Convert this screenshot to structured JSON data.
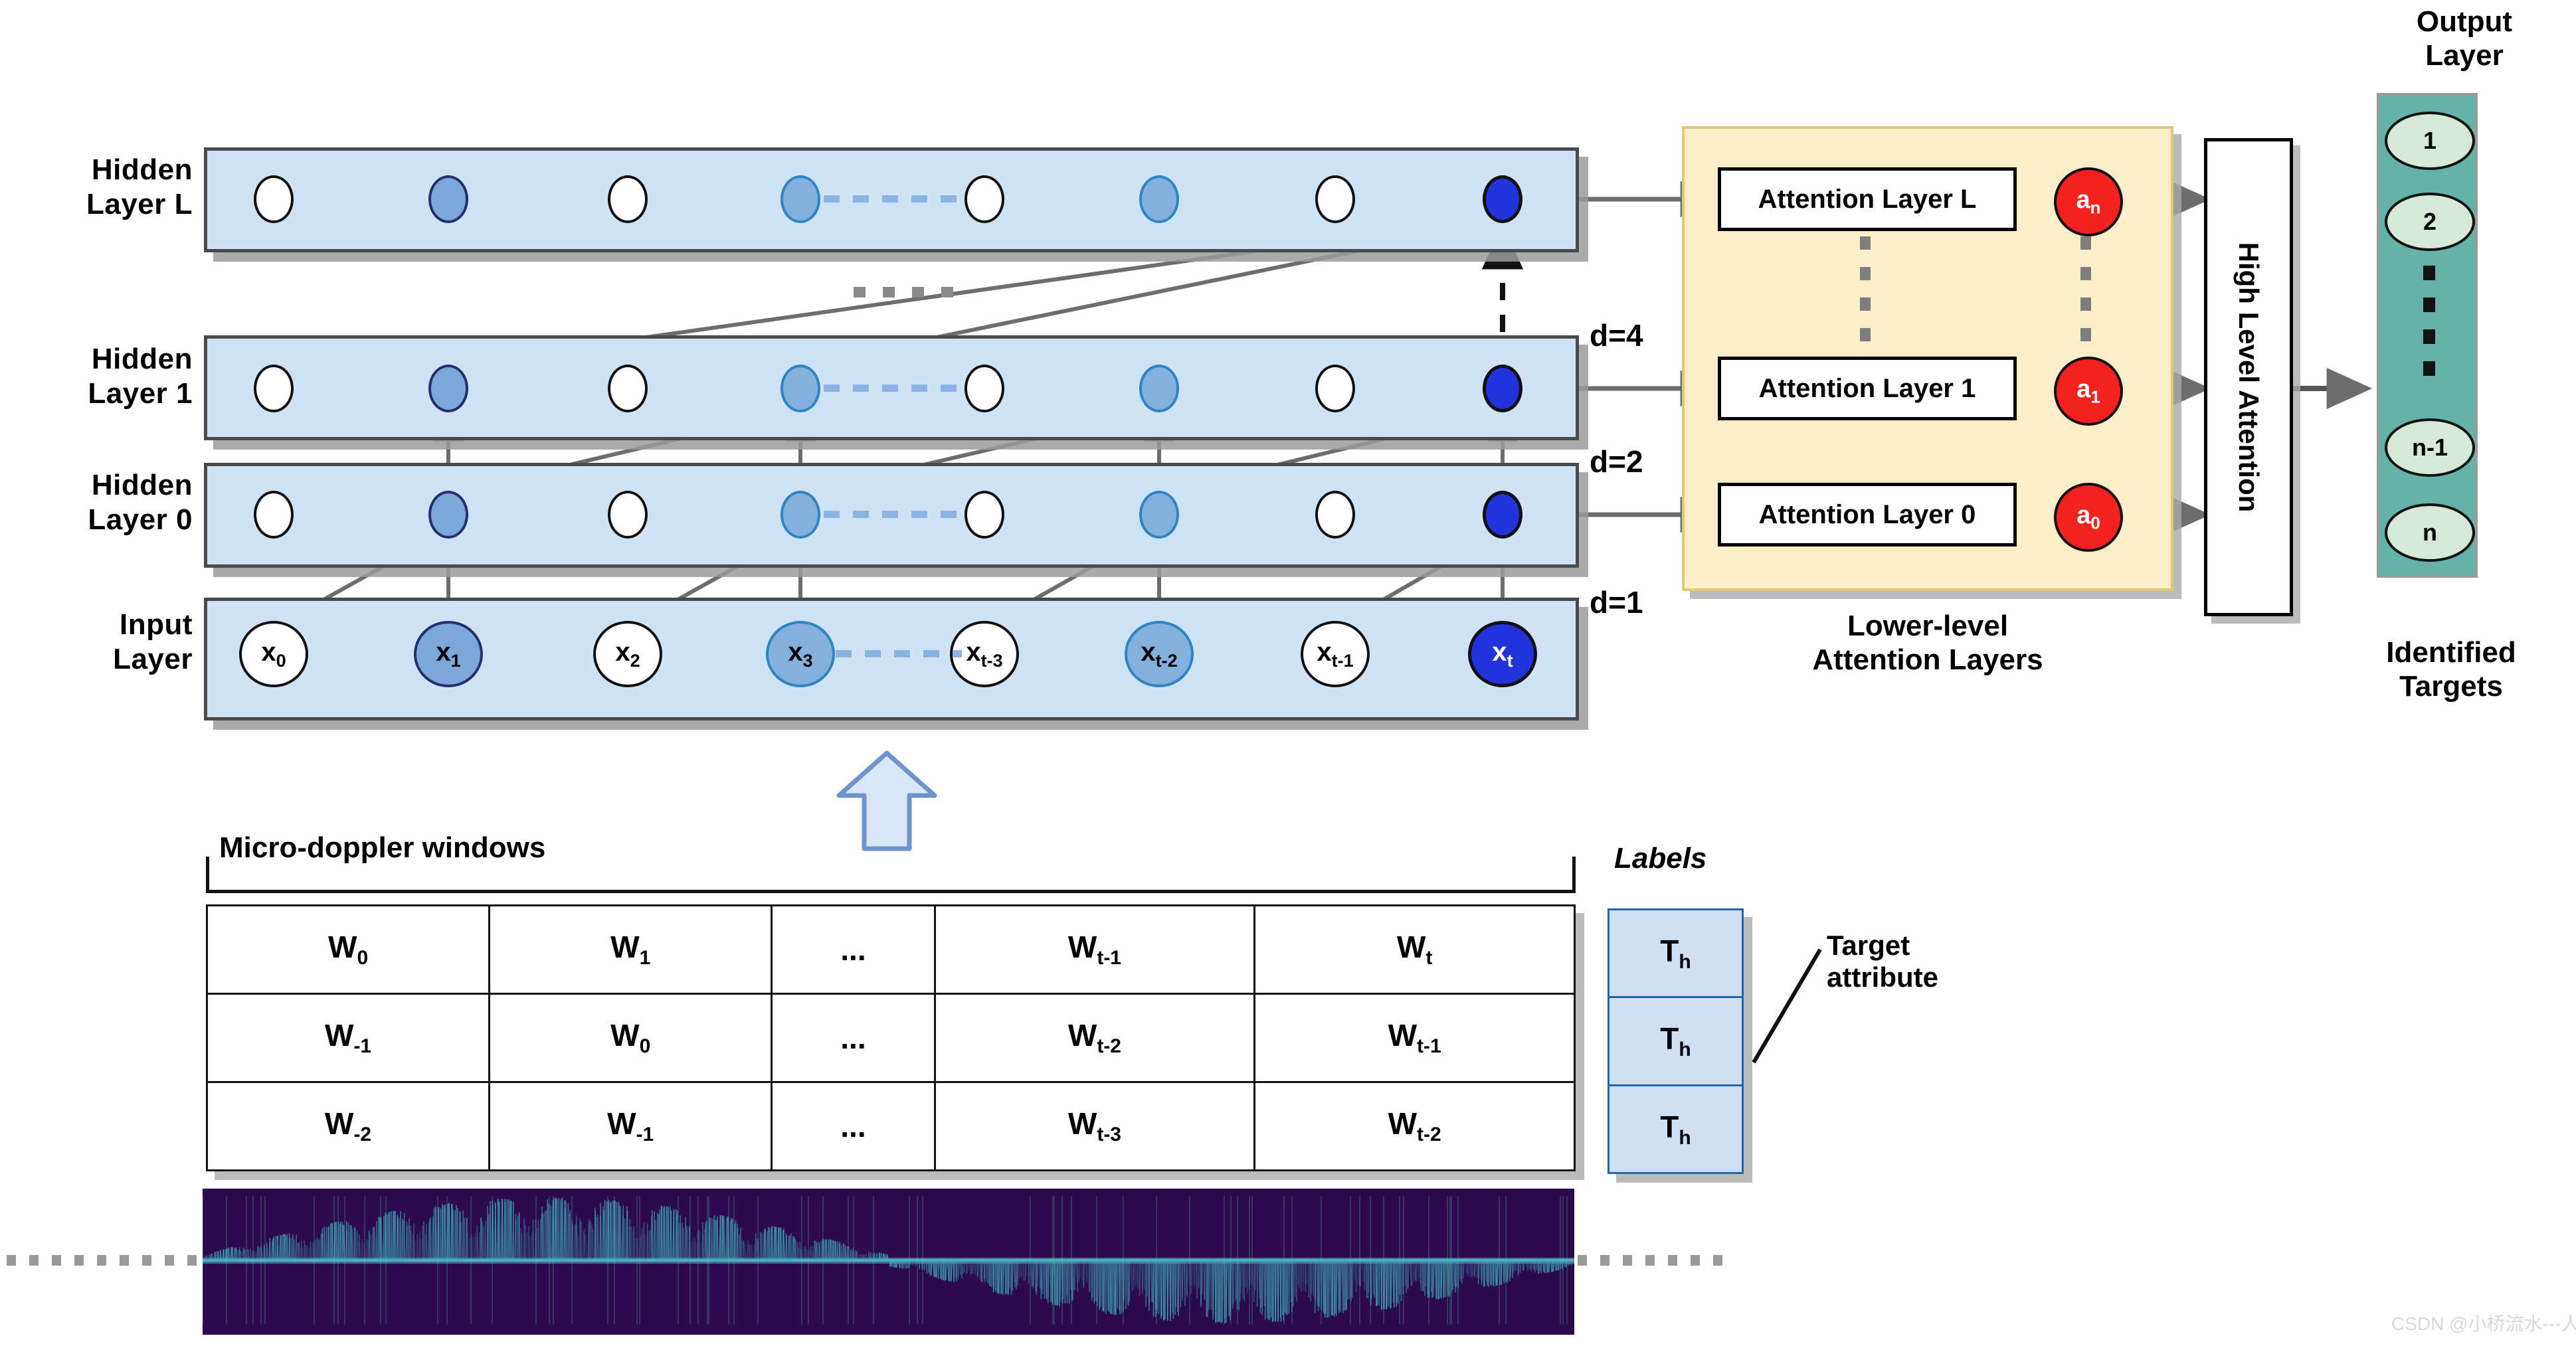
{
  "rows": {
    "hidden_L": "Hidden\nLayer  L",
    "hidden_L_line1": "Hidden",
    "hidden_L_line2": "Layer  L",
    "hidden_1_line1": "Hidden",
    "hidden_1_line2": "Layer  1",
    "hidden_0_line1": "Hidden",
    "hidden_0_line2": "Layer 0",
    "input_line1": "Input",
    "input_line2": "Layer"
  },
  "input_nodes": [
    {
      "label": "x",
      "sub": "0",
      "style": "white"
    },
    {
      "label": "x",
      "sub": "1",
      "style": "mid"
    },
    {
      "label": "x",
      "sub": "2",
      "style": "white"
    },
    {
      "label": "x",
      "sub": "3",
      "style": "mid2"
    },
    {
      "label": "x",
      "sub": "t-3",
      "style": "white"
    },
    {
      "label": "x",
      "sub": "t-2",
      "style": "mid2"
    },
    {
      "label": "x",
      "sub": "t-1",
      "style": "white"
    },
    {
      "label": "x",
      "sub": "t",
      "style": "deep"
    }
  ],
  "hidden_node_styles": [
    "white",
    "mid",
    "white",
    "mid2",
    "white",
    "mid2",
    "white",
    "deep"
  ],
  "dilations": {
    "d4": "d=4",
    "d2": "d=2",
    "d1": "d=1"
  },
  "attention": {
    "boxes": [
      "Attention Layer L",
      "Attention Layer 1",
      "Attention Layer 0"
    ],
    "circles": [
      {
        "label": "a",
        "sub": "n"
      },
      {
        "label": "a",
        "sub": "1"
      },
      {
        "label": "a",
        "sub": "0"
      }
    ],
    "caption_line1": "Lower-level",
    "caption_line2": "Attention Layers",
    "high_level": "High Level Attention"
  },
  "output": {
    "title_line1": "Output",
    "title_line2": "Layer",
    "nodes": [
      "1",
      "2",
      "n-1",
      "n"
    ],
    "caption_line1": "Identified",
    "caption_line2": "Targets"
  },
  "table": {
    "title": "Micro-doppler windows",
    "labels_title": "Labels",
    "rows": [
      [
        {
          "t": "W",
          "s": "0"
        },
        {
          "t": "W",
          "s": "1"
        },
        {
          "t": "...",
          "s": ""
        },
        {
          "t": "W",
          "s": "t-1"
        },
        {
          "t": "W",
          "s": "t"
        }
      ],
      [
        {
          "t": "W",
          "s": "-1"
        },
        {
          "t": "W",
          "s": "0"
        },
        {
          "t": "...",
          "s": ""
        },
        {
          "t": "W",
          "s": "t-2"
        },
        {
          "t": "W",
          "s": "t-1"
        }
      ],
      [
        {
          "t": "W",
          "s": "-2"
        },
        {
          "t": "W",
          "s": "-1"
        },
        {
          "t": "...",
          "s": ""
        },
        {
          "t": "W",
          "s": "t-3"
        },
        {
          "t": "W",
          "s": "t-2"
        }
      ]
    ],
    "label_cells": [
      {
        "t": "T",
        "s": "h"
      },
      {
        "t": "T",
        "s": "h"
      },
      {
        "t": "T",
        "s": "h"
      }
    ],
    "annotation_line1": "Target",
    "annotation_line2": "attribute"
  },
  "colors": {
    "band_fill": "#cfe3f7",
    "node_deep": "#2233dd",
    "node_mid": "#7ba7dd",
    "attention_panel": "#fbeec8",
    "attention_circle": "#f42121",
    "output_panel": "#63b3a6",
    "output_node": "#d6e8d7",
    "label_cell": "#cfe0f5"
  },
  "watermark": "CSDN @小桥流水---人工智能"
}
